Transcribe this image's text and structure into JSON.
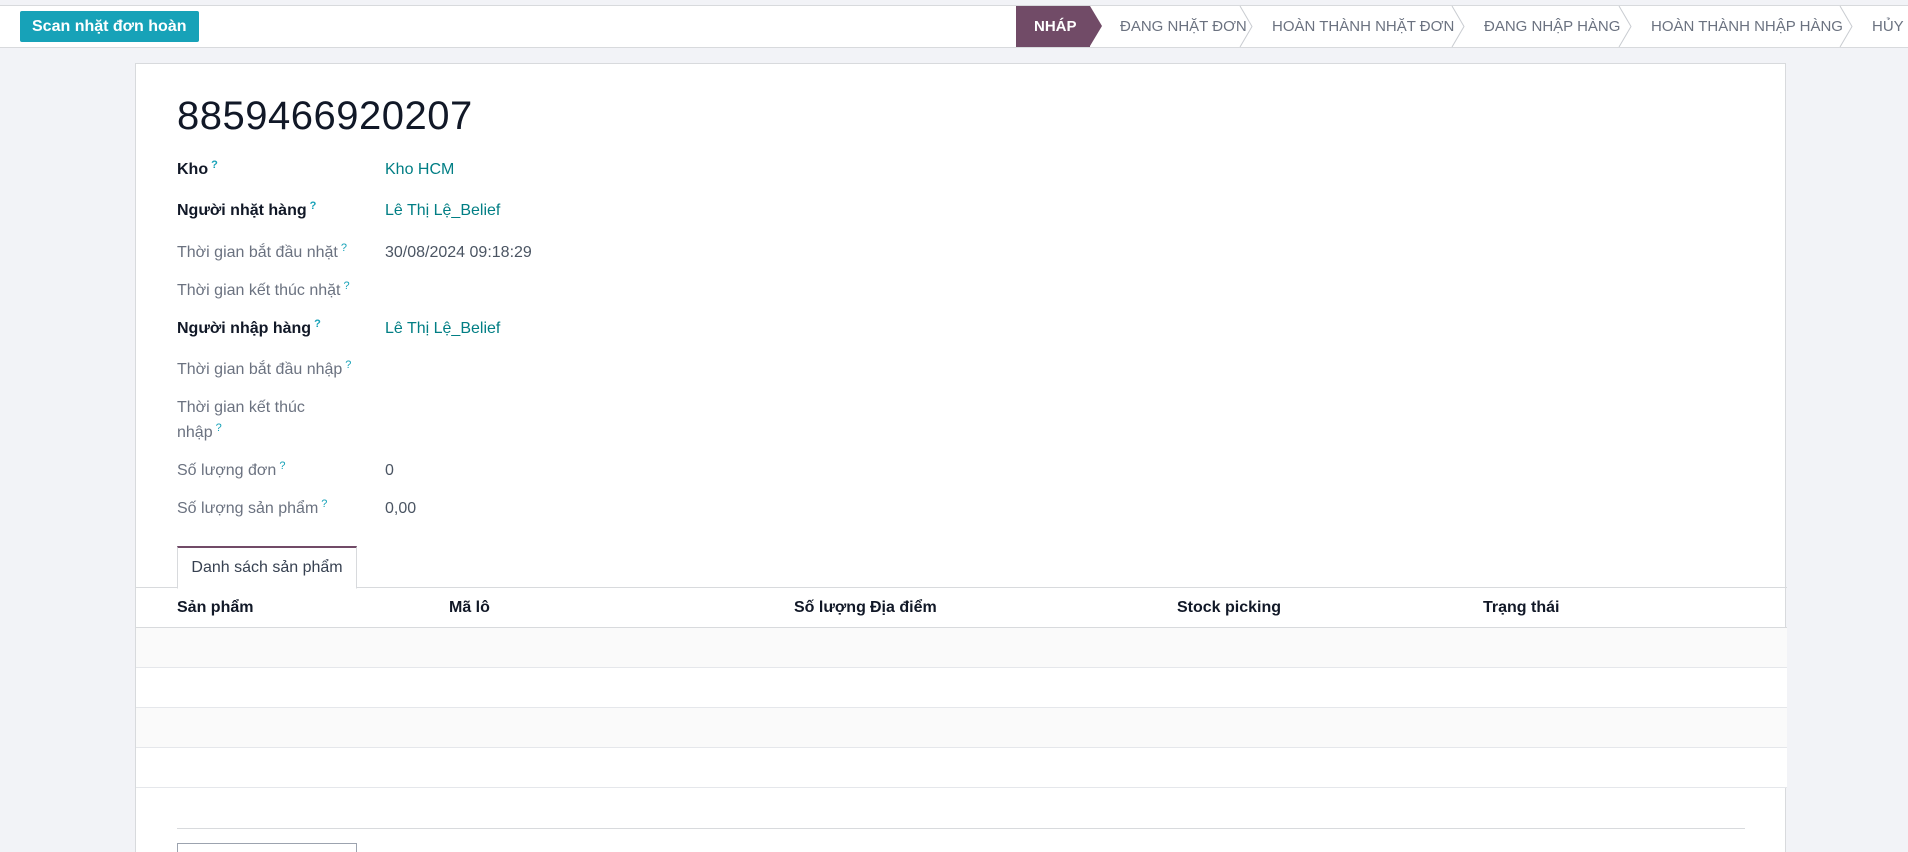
{
  "control": {
    "scan_button_label": "Scan nhặt đơn hoàn"
  },
  "statusbar": {
    "steps": [
      {
        "label": "NHÁP",
        "active": true
      },
      {
        "label": "ĐANG NHẶT ĐƠN",
        "active": false
      },
      {
        "label": "HOÀN THÀNH NHẶT ĐƠN",
        "active": false
      },
      {
        "label": "ĐANG NHẬP HÀNG",
        "active": false
      },
      {
        "label": "HOÀN THÀNH NHẬP HÀNG",
        "active": false
      },
      {
        "label": "HỦY",
        "active": false
      }
    ]
  },
  "record": {
    "name": "8859466920207"
  },
  "fields": {
    "kho": {
      "label": "Kho",
      "value": "Kho HCM"
    },
    "nguoi_nhat_hang": {
      "label": "Người nhặt hàng",
      "value": "Lê Thị Lệ_Belief"
    },
    "tg_bat_dau_nhat": {
      "label": "Thời gian bắt đầu nhặt",
      "value": "30/08/2024 09:18:29"
    },
    "tg_ket_thuc_nhat": {
      "label": "Thời gian kết thúc nhặt",
      "value": ""
    },
    "nguoi_nhap_hang": {
      "label": "Người nhập hàng",
      "value": "Lê Thị Lệ_Belief"
    },
    "tg_bat_dau_nhap": {
      "label": "Thời gian bắt đầu nhập",
      "value": ""
    },
    "tg_ket_thuc_nhap_line1": "Thời gian kết thúc",
    "tg_ket_thuc_nhap_line2": "nhập",
    "so_luong_don": {
      "label": "Số lượng đơn",
      "value": "0"
    },
    "so_luong_san_pham": {
      "label": "Số lượng sản phẩm",
      "value": "0,00"
    }
  },
  "tooltip_mark": "?",
  "notebook": {
    "tab_label": "Danh sách sản phẩm",
    "columns": [
      "Sản phẩm",
      "Mã lô",
      "Số lượng",
      "Địa điểm",
      "Stock picking",
      "Trạng thái"
    ]
  }
}
